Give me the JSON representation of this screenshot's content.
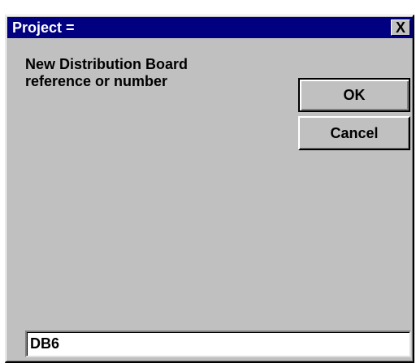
{
  "window": {
    "title": "Project =",
    "close_glyph": "X"
  },
  "dialog": {
    "prompt": "New Distribution Board reference or number",
    "ok_label": "OK",
    "cancel_label": "Cancel",
    "input_value": "DB6"
  },
  "colors": {
    "titlebar": "#000080",
    "dialog_face": "#c0c0c0",
    "input_background": "#ffffff"
  }
}
